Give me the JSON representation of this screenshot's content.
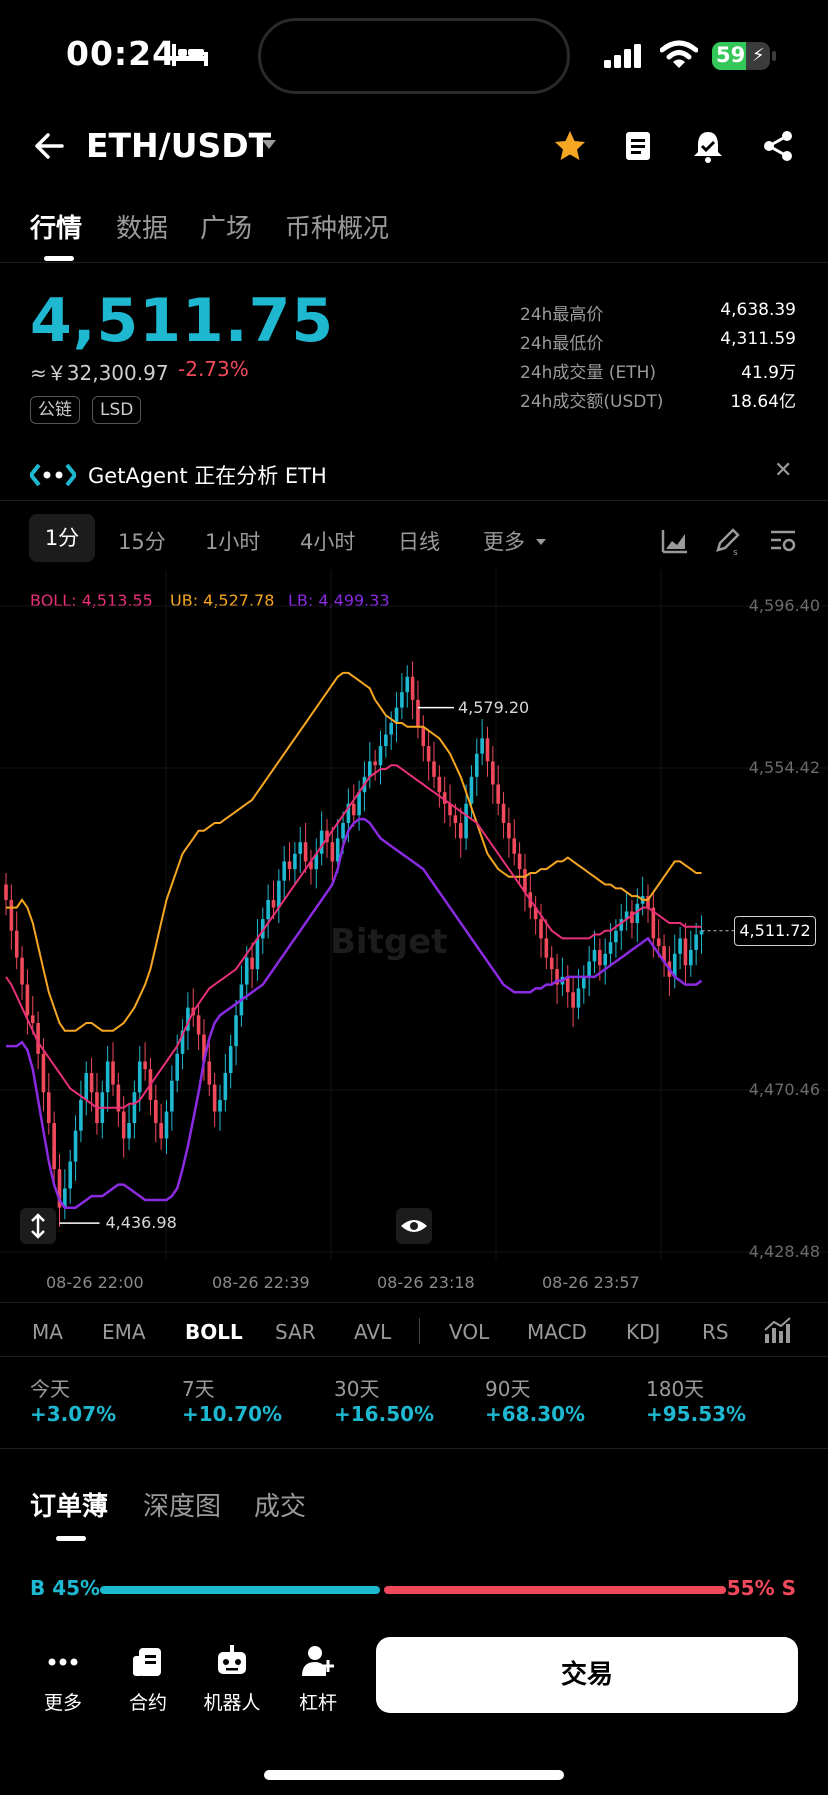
{
  "status": {
    "time": "00:24",
    "battery": "59",
    "battery_level": 0.59
  },
  "header": {
    "pair": "ETH/USDT"
  },
  "tabs": [
    "行情",
    "数据",
    "广场",
    "币种概况"
  ],
  "price": {
    "last": "4,511.75",
    "cny": "≈￥32,300.97",
    "change": "-2.73%",
    "tags": [
      "公链",
      "LSD"
    ]
  },
  "stats": [
    {
      "label": "24h最高价",
      "value": "4,638.39"
    },
    {
      "label": "24h最低价",
      "value": "4,311.59"
    },
    {
      "label": "24h成交量 (ETH)",
      "value": "41.9万"
    },
    {
      "label": "24h成交额(USDT)",
      "value": "18.64亿"
    }
  ],
  "agent": {
    "text": "GetAgent 正在分析 ETH"
  },
  "intervals": {
    "items": [
      "1分",
      "15分",
      "1小时",
      "4小时",
      "日线"
    ],
    "more": "更多"
  },
  "boll_legend": {
    "boll": "BOLL: 4,513.55",
    "ub": "UB: 4,527.78",
    "lb": "LB: 4,499.33"
  },
  "chart": {
    "watermark": "Bitget",
    "y_ticks": [
      "4,596.40",
      "4,554.42",
      "4,470.46",
      "4,428.48"
    ],
    "x_ticks": [
      "08-26 22:00",
      "08-26 22:39",
      "08-26 23:18",
      "08-26 23:57"
    ],
    "high_label": "4,579.20",
    "low_label": "4,436.98",
    "current": "4,511.72"
  },
  "chart_data": {
    "type": "candlestick",
    "interval": "1m",
    "ylim": [
      4428.48,
      4596.4
    ],
    "colors": {
      "up": "#1fb8d1",
      "down": "#f0495c",
      "boll": "#e8307a",
      "ub": "#f5a623",
      "lb": "#8a2be2"
    },
    "close": [
      4520,
      4512,
      4505,
      4498,
      4490,
      4488,
      4480,
      4470,
      4462,
      4450,
      4440,
      4445,
      4452,
      4460,
      4468,
      4475,
      4470,
      4462,
      4470,
      4478,
      4472,
      4465,
      4458,
      4462,
      4470,
      4478,
      4476,
      4468,
      4462,
      4458,
      4465,
      4473,
      4480,
      4486,
      4492,
      4490,
      4485,
      4478,
      4472,
      4465,
      4468,
      4475,
      4482,
      4490,
      4498,
      4505,
      4502,
      4510,
      4515,
      4520,
      4518,
      4525,
      4530,
      4528,
      4532,
      4535,
      4530,
      4528,
      4532,
      4538,
      4535,
      4530,
      4536,
      4540,
      4545,
      4542,
      4548,
      4552,
      4556,
      4555,
      4560,
      4563,
      4566,
      4570,
      4574,
      4578,
      4572,
      4565,
      4560,
      4556,
      4552,
      4548,
      4545,
      4542,
      4540,
      4536,
      4545,
      4552,
      4558,
      4562,
      4556,
      4550,
      4545,
      4540,
      4536,
      4532,
      4528,
      4522,
      4518,
      4515,
      4510,
      4505,
      4502,
      4498,
      4500,
      4496,
      4492,
      4497,
      4500,
      4504,
      4507,
      4503,
      4506,
      4509,
      4512,
      4515,
      4517,
      4514,
      4519,
      4521,
      4518,
      4510,
      4508,
      4504,
      4500,
      4506,
      4510,
      4503,
      4507,
      4511,
      4512
    ],
    "boll": [
      4500,
      4498,
      4495,
      4492,
      4489,
      4486,
      4483,
      4481,
      4479,
      4477,
      4475,
      4473,
      4471,
      4470,
      4469,
      4468,
      4467,
      4466,
      4466,
      4466,
      4466,
      4466,
      4466,
      4467,
      4467,
      4468,
      4470,
      4472,
      4474,
      4476,
      4478,
      4480,
      4482,
      4485,
      4488,
      4491,
      4493,
      4495,
      4497,
      4498,
      4499,
      4500,
      4501,
      4502,
      4504,
      4506,
      4508,
      4510,
      4512,
      4514,
      4516,
      4518,
      4520,
      4522,
      4524,
      4526,
      4528,
      4530,
      4532,
      4534,
      4536,
      4538,
      4540,
      4542,
      4544,
      4546,
      4548,
      4550,
      4552,
      4553,
      4554,
      4554,
      4555,
      4555,
      4554,
      4553,
      4552,
      4551,
      4550,
      4549,
      4548,
      4547,
      4546,
      4545,
      4544,
      4543,
      4542,
      4541,
      4540,
      4538,
      4536,
      4534,
      4532,
      4530,
      4528,
      4526,
      4524,
      4522,
      4520,
      4518,
      4516,
      4514,
      4512,
      4511,
      4510,
      4510,
      4510,
      4510,
      4510,
      4510,
      4511,
      4511,
      4512,
      4512,
      4513,
      4514,
      4515,
      4516,
      4517,
      4518,
      4518,
      4517,
      4516,
      4515,
      4514,
      4514,
      4514,
      4513,
      4513,
      4513,
      4513
    ],
    "ub": [
      4518,
      4518,
      4518,
      4520,
      4518,
      4514,
      4508,
      4502,
      4496,
      4492,
      4488,
      4486,
      4486,
      4486,
      4487,
      4488,
      4488,
      4487,
      4486,
      4486,
      4486,
      4487,
      4488,
      4490,
      4492,
      4495,
      4498,
      4502,
      4508,
      4514,
      4520,
      4524,
      4528,
      4532,
      4534,
      4536,
      4538,
      4538,
      4539,
      4540,
      4540,
      4541,
      4542,
      4543,
      4544,
      4545,
      4546,
      4548,
      4550,
      4552,
      4554,
      4556,
      4558,
      4560,
      4562,
      4564,
      4566,
      4568,
      4570,
      4572,
      4574,
      4576,
      4578,
      4579,
      4579,
      4578,
      4577,
      4576,
      4575,
      4572,
      4570,
      4568,
      4567,
      4566,
      4566,
      4565,
      4565,
      4565,
      4565,
      4564,
      4563,
      4562,
      4560,
      4558,
      4555,
      4552,
      4548,
      4544,
      4540,
      4536,
      4532,
      4530,
      4528,
      4527,
      4526,
      4526,
      4526,
      4526,
      4527,
      4527,
      4528,
      4528,
      4529,
      4530,
      4530,
      4531,
      4530,
      4529,
      4528,
      4527,
      4526,
      4525,
      4524,
      4524,
      4523,
      4523,
      4522,
      4521,
      4521,
      4520,
      4520,
      4522,
      4524,
      4526,
      4528,
      4530,
      4530,
      4529,
      4528,
      4527,
      4527
    ],
    "lb": [
      4482,
      4482,
      4482,
      4483,
      4481,
      4476,
      4468,
      4460,
      4452,
      4446,
      4442,
      4440,
      4440,
      4440,
      4441,
      4442,
      4443,
      4443,
      4443,
      4444,
      4445,
      4446,
      4446,
      4445,
      4444,
      4443,
      4442,
      4442,
      4442,
      4442,
      4442,
      4443,
      4445,
      4450,
      4456,
      4463,
      4470,
      4478,
      4484,
      4488,
      4490,
      4491,
      4492,
      4493,
      4494,
      4495,
      4496,
      4497,
      4498,
      4500,
      4502,
      4504,
      4506,
      4508,
      4510,
      4512,
      4514,
      4516,
      4518,
      4520,
      4522,
      4524,
      4528,
      4534,
      4538,
      4540,
      4541,
      4541,
      4540,
      4538,
      4536,
      4535,
      4534,
      4533,
      4532,
      4531,
      4530,
      4529,
      4528,
      4526,
      4524,
      4522,
      4520,
      4518,
      4516,
      4514,
      4512,
      4510,
      4508,
      4506,
      4504,
      4502,
      4500,
      4498,
      4497,
      4496,
      4496,
      4496,
      4496,
      4497,
      4497,
      4498,
      4498,
      4499,
      4499,
      4500,
      4500,
      4500,
      4500,
      4500,
      4500,
      4501,
      4502,
      4503,
      4504,
      4505,
      4506,
      4507,
      4508,
      4509,
      4510,
      4508,
      4506,
      4504,
      4502,
      4500,
      4499,
      4498,
      4498,
      4498,
      4499
    ]
  },
  "indicators": {
    "main": [
      "MA",
      "EMA",
      "BOLL",
      "SAR",
      "AVL"
    ],
    "sub": [
      "VOL",
      "MACD",
      "KDJ",
      "RS"
    ],
    "active": "BOLL"
  },
  "performance": [
    {
      "label": "今天",
      "value": "+3.07%"
    },
    {
      "label": "7天",
      "value": "+10.70%"
    },
    {
      "label": "30天",
      "value": "+16.50%"
    },
    {
      "label": "90天",
      "value": "+68.30%"
    },
    {
      "label": "180天",
      "value": "+95.53%"
    }
  ],
  "orderbook": {
    "tabs": [
      "订单薄",
      "深度图",
      "成交"
    ],
    "buy_label": "B 45%",
    "sell_label": "55% S",
    "buy_ratio": 0.45
  },
  "nav": {
    "items": [
      "更多",
      "合约",
      "机器人",
      "杠杆"
    ],
    "trade": "交易"
  }
}
